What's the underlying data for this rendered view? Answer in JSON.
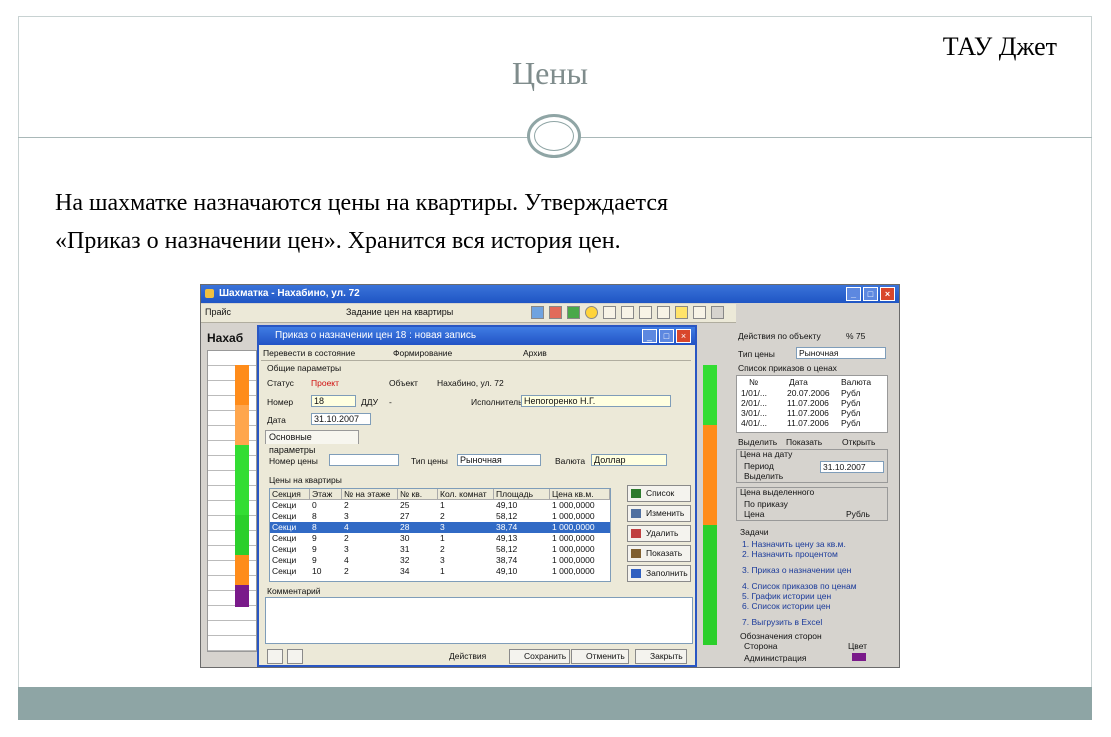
{
  "slide": {
    "brand": "ТАУ Джет",
    "title": "Цены",
    "body_lines": [
      "На шахматке назначаются цены на квартиры. Утверждается",
      "«Приказ о назначении цен». Хранится вся история цен."
    ]
  },
  "app": {
    "window_title": "Шахматка - Нахабино, ул. 72",
    "menu_left": "Прайс",
    "menu_center": "Задание цен на квартиры",
    "left_header": "Нахаб",
    "colors": {
      "title_bar": "#2557c8",
      "selected_row": "#316ac5",
      "orange": "#ff8c1a",
      "green": "#33dd33",
      "purple": "#7a1a8a"
    }
  },
  "dialog": {
    "title": "Приказ о назначении цен 18 : новая запись",
    "menus": [
      "Перевести в состояние",
      "Формирование",
      "Архив"
    ],
    "group_general": "Общие параметры",
    "status_label": "Статус",
    "status_value": "Проект",
    "object_label": "Объект",
    "object_value": "Нахабино, ул. 72",
    "number_label": "Номер",
    "number_value": "18",
    "ddu_label": "ДДУ",
    "ddu_value": "-",
    "executor_label": "Исполнитель",
    "executor_value": "Непогоренко Н.Г.",
    "date_label": "Дата",
    "date_value": "31.10.2007",
    "tab_main": "Основные параметры",
    "price_no_label": "Номер цены",
    "price_type_label": "Тип цены",
    "price_type_value": "Рыночная",
    "currency_label": "Валюта",
    "currency_value": "Доллар",
    "group_prices": "Цены на квартиры",
    "columns": [
      "Секция",
      "Этаж",
      "№ на этаже",
      "№ кв.",
      "Кол. комнат",
      "Площадь",
      "Цена кв.м."
    ],
    "rows": [
      [
        "Секци",
        "0",
        "2",
        "25",
        "1",
        "49,10",
        "1 000,0000"
      ],
      [
        "Секци",
        "8",
        "3",
        "27",
        "2",
        "58,12",
        "1 000,0000"
      ],
      [
        "Секци",
        "8",
        "4",
        "28",
        "3",
        "38,74",
        "1 000,0000"
      ],
      [
        "Секци",
        "9",
        "2",
        "30",
        "1",
        "49,13",
        "1 000,0000"
      ],
      [
        "Секци",
        "9",
        "3",
        "31",
        "2",
        "58,12",
        "1 000,0000"
      ],
      [
        "Секци",
        "9",
        "4",
        "32",
        "3",
        "38,74",
        "1 000,0000"
      ],
      [
        "Секци",
        "10",
        "2",
        "34",
        "1",
        "49,10",
        "1 000,0000"
      ]
    ],
    "selected_row": 2,
    "side_buttons": [
      "Список",
      "Изменить",
      "Удалить",
      "Показать",
      "Заполнить"
    ],
    "comment_label": "Комментарий",
    "bottom_buttons": [
      "Действия",
      "Сохранить",
      "Отменить",
      "Закрыть"
    ]
  },
  "right_panel": {
    "actions": "Действия по объекту",
    "pct": "% 75",
    "price_type_label": "Тип цены",
    "price_type_value": "Рыночная",
    "orders_group": "Список приказов о ценах",
    "order_cols": [
      "№",
      "Дата",
      "Валюта"
    ],
    "orders": [
      [
        "1/01/...",
        "20.07.2006",
        "Рубл"
      ],
      [
        "2/01/...",
        "11.07.2006",
        "Рубл"
      ],
      [
        "3/01/...",
        "11.07.2006",
        "Рубл"
      ],
      [
        "4/01/...",
        "11.07.2006",
        "Рубл"
      ]
    ],
    "order_actions": [
      "Выделить",
      "Показать",
      "Открыть"
    ],
    "price_on_date": "Цена на дату",
    "price_on_date_value": "31.10.2007",
    "period_label": "Период",
    "select_label": "Выделить",
    "selected_price": "Цена выделенного",
    "by_order": "По приказу",
    "price_label": "Цена",
    "price_unit": "Рубль",
    "tasks_title": "Задачи",
    "tasks_a": [
      "1. Назначить цену за кв.м.",
      "2. Назначить процентом"
    ],
    "task_3": "3. Приказ о назначении цен",
    "tasks_b": [
      "4. Список приказов по ценам",
      "5. График истории цен",
      "6. Список истории цен"
    ],
    "task_7": "7. Выгрузить в Excel",
    "legend_title": "Обозначения сторон",
    "legend_cols": [
      "Сторона",
      "Цвет"
    ],
    "legend_row": "Администрация"
  }
}
